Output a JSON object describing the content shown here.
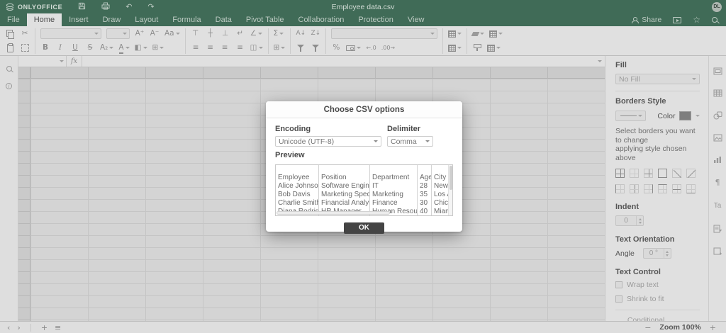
{
  "topbar": {
    "brand": "ONLYOFFICE",
    "title": "Employee data.csv",
    "avatar_initials": "DL"
  },
  "tabbar": {
    "tabs": [
      "File",
      "Home",
      "Insert",
      "Draw",
      "Layout",
      "Formula",
      "Data",
      "Pivot Table",
      "Collaboration",
      "Protection",
      "View"
    ],
    "active_tab": "Home",
    "share_label": "Share"
  },
  "icons": {
    "cut": "✂",
    "font_inc": "A⁺",
    "font_dec": "A⁻",
    "change_case": "Aa",
    "valign_top": "⊤",
    "valign_middle": "┼",
    "valign_bottom": "⊥",
    "wrap_text": "↵",
    "orientation": "∠",
    "autosum": "Σ",
    "sort_az": "A↓",
    "sort_za": "Z↓",
    "bold": "B",
    "italic": "I",
    "underline": "U",
    "strikeout": "S",
    "subscript": "A₂",
    "font_color": "A",
    "fill_color": "◧",
    "cell_borders": "⊞",
    "align_left": "≡",
    "align_center": "≡",
    "align_right": "≡",
    "align_justify": "≡",
    "merge_cells": "◫",
    "named_ranges": "⊞",
    "percent_style": "%",
    "decrease_decimal": "←.0",
    "increase_decimal": ".00→",
    "undo": "↶",
    "redo": "↷",
    "star": "☆",
    "paragraph_settings": "¶",
    "text_art_settings": "Ta",
    "info": "i",
    "fx": "fx",
    "nav_prev": "‹",
    "nav_next": "›",
    "add_sheet": "+",
    "sheet_list": "≡",
    "zoom_out": "−",
    "zoom_in": "+"
  },
  "sidebar": {
    "fill": {
      "label": "Fill",
      "value": "No Fill"
    },
    "borders": {
      "label": "Borders Style",
      "color_label": "Color",
      "swatch_color": "#7e7e7e",
      "hint_line1": "Select borders you want to change",
      "hint_line2": "applying style chosen above",
      "buttons_row1": [
        "border-all",
        "border-none",
        "border-inside",
        "border-outside",
        "border-diagonal-down",
        "border-diagonal-up"
      ],
      "buttons_row2": [
        "border-left",
        "border-inside-vertical",
        "border-right",
        "border-top",
        "border-inside-horizontal",
        "border-bottom"
      ]
    },
    "indent": {
      "label": "Indent",
      "value": "0"
    },
    "orientation": {
      "label": "Text Orientation",
      "angle_label": "Angle",
      "angle_value": "0 °"
    },
    "text_control": {
      "label": "Text Control",
      "wrap_label": "Wrap text",
      "shrink_label": "Shrink to fit"
    },
    "conditional_label": "Conditional formatting"
  },
  "statusbar": {
    "zoom_label": "Zoom 100%"
  },
  "dialog": {
    "title": "Choose CSV options",
    "encoding_label": "Encoding",
    "encoding_value": "Unicode (UTF-8)",
    "delimiter_label": "Delimiter",
    "delimiter_value": "Comma",
    "preview_label": "Preview",
    "ok_label": "OK",
    "preview": {
      "rows": [
        [
          "",
          "",
          "",
          "",
          ""
        ],
        [
          "Employee",
          "Position",
          "Department",
          "Age",
          "City of R"
        ],
        [
          "Alice Johnson",
          "Software Engineer",
          "IT",
          "28",
          "New Yor"
        ],
        [
          "Bob Davis",
          "Marketing Specialist",
          "Marketing",
          "35",
          "Los Ange"
        ],
        [
          "Charlie Smith",
          "Financial Analyst",
          "Finance",
          "30",
          "Chicago"
        ],
        [
          "Diana Rodriguez",
          "HR Manager",
          "Human Resources",
          "40",
          "Miami"
        ]
      ]
    }
  },
  "colors": {
    "header_green": "#406b57",
    "ok_button": "#444444",
    "border_swatch": "#7e7e7e"
  }
}
